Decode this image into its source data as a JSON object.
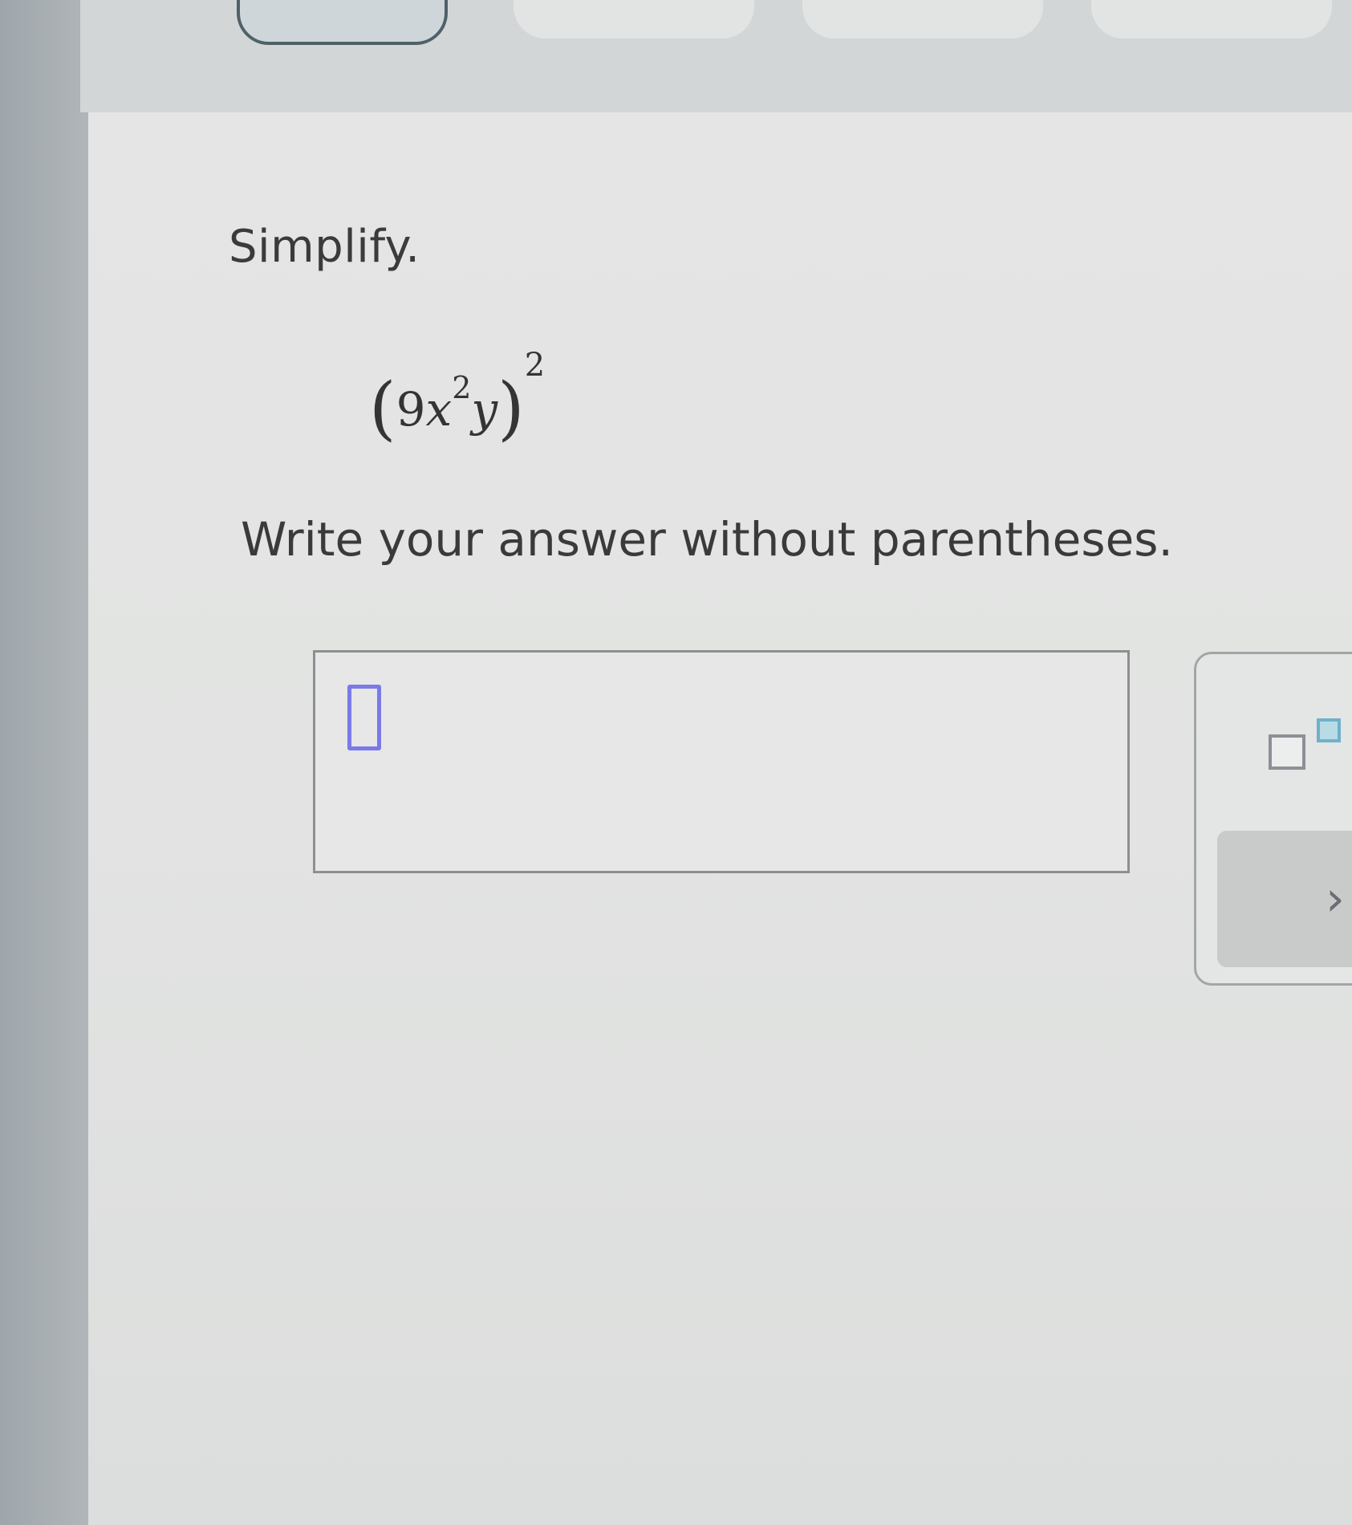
{
  "problem": {
    "prompt": "Simplify.",
    "expression": {
      "open_paren": "(",
      "coefficient": "9",
      "variable_1": "x",
      "variable_1_exponent": "2",
      "variable_2": "y",
      "close_paren": ")",
      "outer_exponent": "2"
    },
    "instruction": "Write your answer without parentheses."
  },
  "answer": {
    "value": ""
  },
  "toolbar": {
    "exponent_icon": "superscript-template-icon",
    "action_icon_glyph": "›"
  },
  "colors": {
    "cursor": "#7a79e8",
    "exponent_accent": "#6fb1c9",
    "active_nav_border": "#4f6168"
  }
}
